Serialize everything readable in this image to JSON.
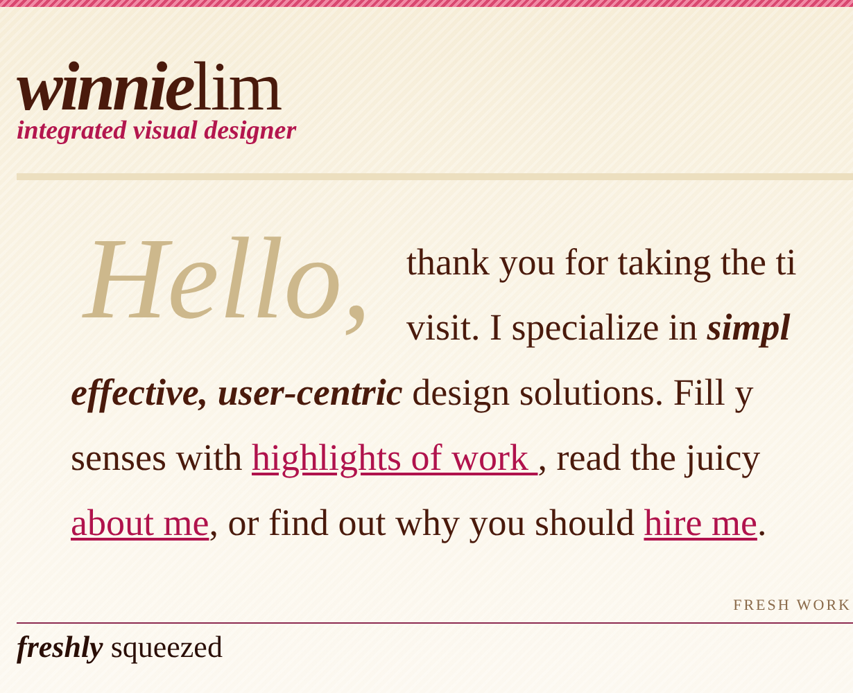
{
  "header": {
    "logo_bold": "winnie",
    "logo_rest": "lim",
    "tagline": "integrated visual designer"
  },
  "intro": {
    "greeting": "Hello,",
    "lines": [
      {
        "segments": [
          {
            "kind": "text",
            "text": "thank you for taking the ti"
          }
        ]
      },
      {
        "segments": [
          {
            "kind": "text",
            "text": "visit. I specialize in **simpl**"
          }
        ]
      },
      {
        "segments": [
          {
            "kind": "text",
            "text": "**effective, user-centric** design solutions. Fill y"
          }
        ]
      },
      {
        "segments": [
          {
            "kind": "text",
            "text": "senses with "
          },
          {
            "kind": "link",
            "text": "highlights of work "
          },
          {
            "kind": "text",
            "text": ", read the juicy"
          }
        ]
      },
      {
        "segments": [
          {
            "kind": "link",
            "text": "about me"
          },
          {
            "kind": "text",
            "text": ", or find out why you should "
          },
          {
            "kind": "link",
            "text": "hire me"
          },
          {
            "kind": "text",
            "text": "."
          }
        ]
      }
    ]
  },
  "section": {
    "label": "FRESH WORK",
    "heading": "**freshly** squeezed"
  }
}
